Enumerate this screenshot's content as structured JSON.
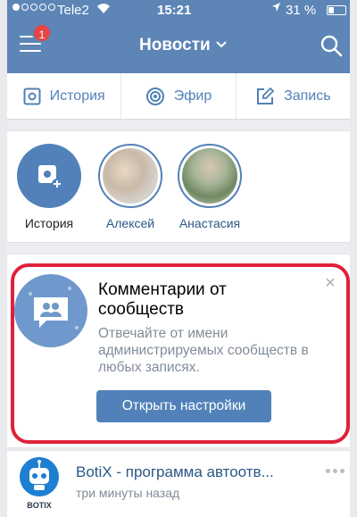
{
  "status_bar": {
    "carrier": "Tele2",
    "time": "15:21",
    "battery": "31 %",
    "battery_level": 0.31
  },
  "header": {
    "title": "Новости",
    "notification_count": "1",
    "icons": [
      "menu-icon",
      "chevron-down-icon",
      "search-icon"
    ]
  },
  "actions": [
    {
      "label": "История",
      "icon": "camera-square-icon"
    },
    {
      "label": "Эфир",
      "icon": "live-broadcast-icon"
    },
    {
      "label": "Запись",
      "icon": "edit-icon"
    }
  ],
  "stories": [
    {
      "label": "История"
    },
    {
      "label": "Алексей"
    },
    {
      "label": "Анастасия"
    }
  ],
  "promo": {
    "title": "Комментарии от сообществ",
    "text": "Отвечайте от имени администрируемых сообществ в любых записях.",
    "button": "Открыть настройки",
    "close": "×",
    "highlight_color": "#e0203a"
  },
  "post": {
    "author": "BotiX - программа автоотв...",
    "time": "три минуты назад",
    "logo_text": "BOTIX"
  },
  "colors": {
    "accent": "#5181b8",
    "header": "#5d85b6",
    "badge": "#e64646"
  }
}
